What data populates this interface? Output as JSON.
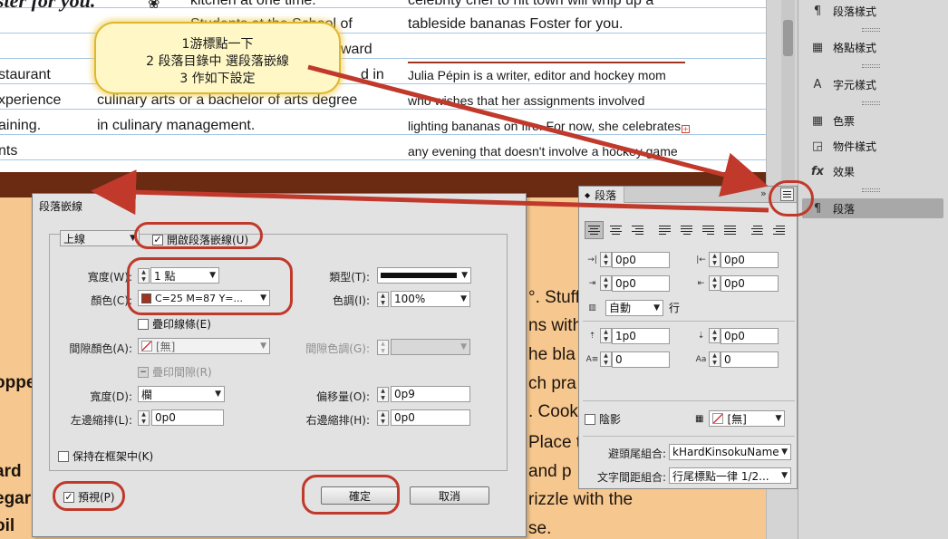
{
  "document": {
    "col1_lines": [
      "staurant",
      "xperience",
      "aining.",
      "nts"
    ],
    "col1_heading": "ster for you.",
    "col2_lines": [
      "kitchen at one time.",
      "Students at the School of",
      "ward",
      "d in",
      "culinary arts or a bachelor of arts degree",
      "in culinary management."
    ],
    "col3_lines": [
      "celebrity chef to hit town will whip up a",
      "tableside bananas Foster for you.",
      "Julia Pépin is a writer, editor and hockey mom",
      "who wishes that her assignments involved",
      "lighting bananas on fire. For now, she celebrates",
      "any evening that doesn't involve a hockey game"
    ],
    "peach_left": [
      "opped",
      "ard",
      "egar",
      "oil"
    ],
    "peach_right": [
      "°. Stuff",
      "ns with",
      "he bla",
      "ch pra",
      ". Cook",
      "Place th",
      "and p",
      "rizzle with the",
      "se."
    ]
  },
  "callout": {
    "line1": "1游標點一下",
    "line2": "2 段落目錄中 選段落嵌線",
    "line3": "3 作如下設定"
  },
  "right_panel": {
    "items": [
      {
        "label": "段落樣式",
        "icon": "paragraph-styles-icon",
        "glyph": "¶"
      },
      {
        "label": "格點樣式",
        "icon": "grid-styles-icon",
        "glyph": "▦"
      },
      {
        "label": "字元樣式",
        "icon": "character-styles-icon",
        "glyph": "A"
      },
      {
        "label": "色票",
        "icon": "swatches-icon",
        "glyph": "▦"
      },
      {
        "label": "物件樣式",
        "icon": "object-styles-icon",
        "glyph": "◲"
      },
      {
        "label": "效果",
        "icon": "effects-icon",
        "glyph": "fx"
      },
      {
        "label": "段落",
        "icon": "paragraph-icon",
        "glyph": "¶"
      }
    ]
  },
  "paragraph_panel": {
    "tab": "段落",
    "left_indent": "0p0",
    "right_indent": "0p0",
    "first_line_indent": "0p0",
    "last_line_indent": "0p0",
    "auto_leading_value": "自動",
    "auto_leading_unit": "行",
    "space_before": "1p0",
    "space_after": "0p0",
    "drop_cap_lines": "0",
    "drop_cap_chars": "0",
    "shading_label": "陰影",
    "shading_swatch": "[無]",
    "kinsoku_label": "避頭尾組合:",
    "kinsoku_value": "kHardKinsokuName",
    "mojikumi_label": "文字間距組合:",
    "mojikumi_value": "行尾標點一律 1/2..."
  },
  "dialog": {
    "title": "段落嵌線",
    "rule_type_select": "上線",
    "enable_label": "開啟段落嵌線(U)",
    "enable_checked": true,
    "weight_label": "寬度(W):",
    "weight_value": "1 點",
    "type_label": "類型(T):",
    "color_label": "顏色(C):",
    "color_value": "C=25 M=87 Y=...",
    "color_swatch": "#a2341f",
    "tint_label": "色調(I):",
    "tint_value": "100%",
    "overprint_stroke_label": "疊印線條(E)",
    "gap_color_label": "間隙顏色(A):",
    "gap_color_value": "[無]",
    "gap_tint_label": "間隙色調(G):",
    "overprint_gap_label": "疊印間隙(R)",
    "width_label": "寬度(D):",
    "width_value": "欄",
    "offset_label": "偏移量(O):",
    "offset_value": "0p9",
    "left_indent_label": "左邊縮排(L):",
    "left_indent_value": "0p0",
    "right_indent_label": "右邊縮排(H):",
    "right_indent_value": "0p0",
    "keep_in_frame_label": "保持在框架中(K)",
    "preview_label": "預視(P)",
    "preview_checked": true,
    "ok_label": "確定",
    "cancel_label": "取消"
  },
  "colors": {
    "annotation_red": "#c0392b",
    "callout_fill": "#fff8c6",
    "rule_color": "#a2341f",
    "brown_band": "#6b2a12",
    "peach_bg": "#f6c88f"
  }
}
